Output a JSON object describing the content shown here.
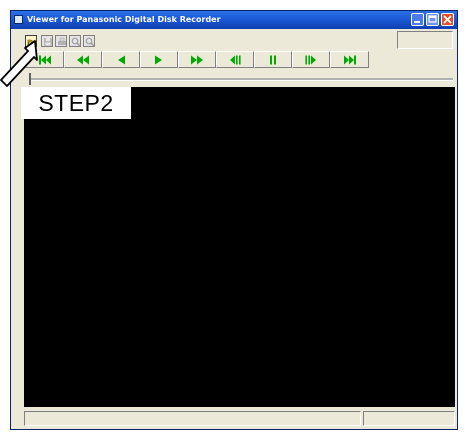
{
  "window": {
    "title": "Viewer for Panasonic Digital Disk Recorder",
    "titlebar_color": "#1b56d4",
    "buttons": [
      {
        "name": "minimize-button",
        "icon": "minimize-icon"
      },
      {
        "name": "maximize-button",
        "icon": "maximize-icon"
      },
      {
        "name": "close-button",
        "icon": "close-icon"
      }
    ]
  },
  "toolbar": {
    "file_buttons": [
      {
        "name": "open-file-button",
        "icon": "open-folder-icon",
        "state": "highlighted"
      },
      {
        "name": "save-button",
        "icon": "floppy-disk-icon",
        "state": "disabled"
      },
      {
        "name": "print-button",
        "icon": "printer-icon",
        "state": "disabled"
      },
      {
        "name": "zoom-in-button",
        "icon": "magnifier-icon",
        "state": "disabled"
      },
      {
        "name": "zoom-out-button",
        "icon": "magnifier-icon",
        "state": "disabled"
      }
    ],
    "playback_buttons": [
      {
        "name": "skip-to-start-button",
        "icon": "skip-to-start-icon"
      },
      {
        "name": "fast-rewind-button",
        "icon": "fast-rewind-icon"
      },
      {
        "name": "reverse-play-button",
        "icon": "reverse-play-icon"
      },
      {
        "name": "play-button",
        "icon": "play-icon"
      },
      {
        "name": "fast-forward-button",
        "icon": "fast-forward-icon"
      },
      {
        "name": "frame-back-button",
        "icon": "frame-back-icon"
      },
      {
        "name": "pause-button",
        "icon": "pause-icon"
      },
      {
        "name": "frame-forward-button",
        "icon": "frame-forward-icon"
      },
      {
        "name": "skip-to-end-button",
        "icon": "skip-to-end-icon"
      }
    ],
    "playback_icon_color": "#00aa00"
  },
  "annotation": {
    "step_label": "STEP2",
    "pointer_icon": "arrow-pointer-icon"
  },
  "video": {
    "background_color": "#000000"
  }
}
